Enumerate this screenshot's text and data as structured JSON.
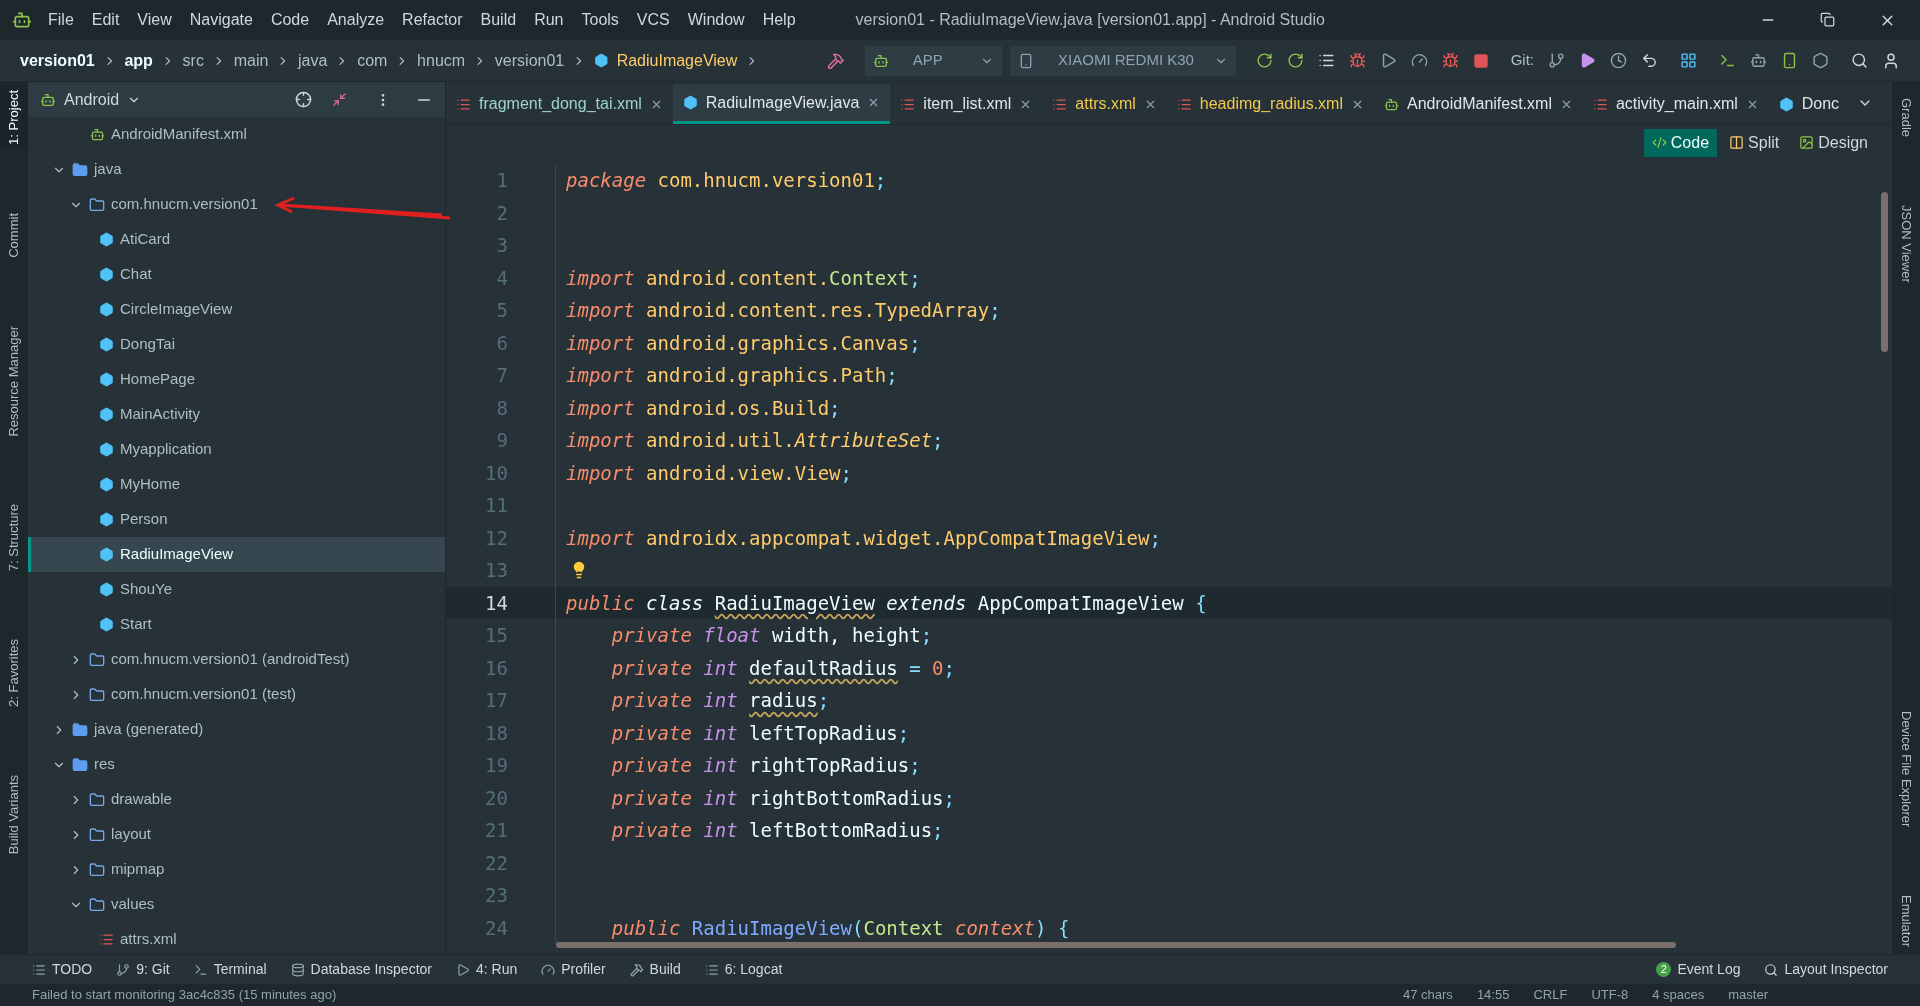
{
  "window": {
    "title": "version01 - RadiuImageView.java [version01.app] - Android Studio"
  },
  "menu": [
    "File",
    "Edit",
    "View",
    "Navigate",
    "Code",
    "Analyze",
    "Refactor",
    "Build",
    "Run",
    "Tools",
    "VCS",
    "Window",
    "Help"
  ],
  "breadcrumb": [
    {
      "label": "version01",
      "kind": "bold"
    },
    {
      "label": "app",
      "kind": "bold"
    },
    {
      "label": "src",
      "kind": "plain"
    },
    {
      "label": "main",
      "kind": "plain"
    },
    {
      "label": "java",
      "kind": "plain"
    },
    {
      "label": "com",
      "kind": "plain"
    },
    {
      "label": "hnucm",
      "kind": "plain"
    },
    {
      "label": "version01",
      "kind": "plain"
    },
    {
      "label": "RadiuImageView",
      "kind": "class"
    }
  ],
  "toolbar": {
    "run_config": "APP",
    "device": "XIAOMI REDMI K30",
    "git_label": "Git:"
  },
  "left_tools": [
    {
      "label": "1: Project",
      "selected": true
    },
    {
      "label": "Commit",
      "selected": false
    },
    {
      "label": "Resource Manager",
      "selected": false
    },
    {
      "label": "7: Structure",
      "selected": false
    },
    {
      "label": "2: Favorites",
      "selected": false
    },
    {
      "label": "Build Variants",
      "selected": false
    }
  ],
  "right_tools": [
    "Gradle",
    "JSON Viewer",
    "Device File Explorer",
    "Emulator"
  ],
  "project": {
    "view": "Android",
    "tree": [
      {
        "label": "AndroidManifest.xml",
        "kind": "manifest",
        "selected": false
      },
      {
        "label": "java",
        "kind": "folder",
        "expanded": true,
        "selected": false,
        "children": [
          {
            "label": "com.hnucm.version01",
            "kind": "package",
            "expanded": true,
            "selected": false,
            "children": [
              {
                "label": "AtiCard",
                "kind": "class",
                "selected": false
              },
              {
                "label": "Chat",
                "kind": "class",
                "selected": false
              },
              {
                "label": "CircleImageView",
                "kind": "class",
                "selected": false
              },
              {
                "label": "DongTai",
                "kind": "class",
                "selected": false
              },
              {
                "label": "HomePage",
                "kind": "class",
                "selected": false
              },
              {
                "label": "MainActivity",
                "kind": "class",
                "selected": false
              },
              {
                "label": "Myapplication",
                "kind": "class",
                "selected": false
              },
              {
                "label": "MyHome",
                "kind": "class",
                "selected": false
              },
              {
                "label": "Person",
                "kind": "class",
                "selected": false
              },
              {
                "label": "RadiuImageView",
                "kind": "class",
                "selected": true
              },
              {
                "label": "ShouYe",
                "kind": "class",
                "selected": false
              },
              {
                "label": "Start",
                "kind": "class",
                "selected": false
              }
            ]
          },
          {
            "label": "com.hnucm.version01 (androidTest)",
            "kind": "package",
            "expanded": false,
            "selected": false
          },
          {
            "label": "com.hnucm.version01 (test)",
            "kind": "package",
            "expanded": false,
            "selected": false
          }
        ]
      },
      {
        "label": "java (generated)",
        "kind": "folder",
        "expanded": false,
        "selected": false
      },
      {
        "label": "res",
        "kind": "folder",
        "expanded": true,
        "selected": false,
        "children": [
          {
            "label": "drawable",
            "kind": "package",
            "expanded": false,
            "selected": false
          },
          {
            "label": "layout",
            "kind": "package",
            "expanded": false,
            "selected": false
          },
          {
            "label": "mipmap",
            "kind": "package",
            "expanded": false,
            "selected": false
          },
          {
            "label": "values",
            "kind": "package",
            "expanded": true,
            "selected": false,
            "children": [
              {
                "label": "attrs.xml",
                "kind": "xml",
                "selected": false
              }
            ]
          }
        ]
      }
    ]
  },
  "tabs": [
    {
      "label": "fragment_dong_tai.xml",
      "kind": "xml",
      "selected": false,
      "color": "#9fd3cc"
    },
    {
      "label": "RadiuImageView.java",
      "kind": "class",
      "selected": true,
      "color": "#e0e6e8"
    },
    {
      "label": "item_list.xml",
      "kind": "xml",
      "selected": false,
      "color": "#e0e6e8"
    },
    {
      "label": "attrs.xml",
      "kind": "xml",
      "selected": false,
      "color": "#f2c94c"
    },
    {
      "label": "headimg_radius.xml",
      "kind": "xml",
      "selected": false,
      "color": "#f2c94c"
    },
    {
      "label": "AndroidManifest.xml",
      "kind": "manifest",
      "selected": false,
      "color": "#e0e6e8"
    },
    {
      "label": "activity_main.xml",
      "kind": "xml",
      "selected": false,
      "color": "#e0e6e8"
    },
    {
      "label": "Donc",
      "kind": "class",
      "selected": false,
      "color": "#e0e6e8"
    }
  ],
  "editor_modes": [
    {
      "label": "Code",
      "selected": true
    },
    {
      "label": "Split",
      "selected": false
    },
    {
      "label": "Design",
      "selected": false
    }
  ],
  "code": [
    {
      "n": "1",
      "current": false,
      "tokens": [
        {
          "text": "package ",
          "kind": "kw"
        },
        {
          "text": "com.hnucm.version01",
          "kind": "pkg"
        },
        {
          "text": ";",
          "kind": "punct"
        }
      ]
    },
    {
      "n": "2",
      "current": false
    },
    {
      "n": "3",
      "current": false
    },
    {
      "n": "4",
      "current": false,
      "tokens": [
        {
          "text": "import ",
          "kind": "kw"
        },
        {
          "text": "android.content.",
          "kind": "pkg"
        },
        {
          "text": "Context",
          "kind": "cls"
        },
        {
          "text": ";",
          "kind": "punct"
        }
      ]
    },
    {
      "n": "5",
      "current": false,
      "tokens": [
        {
          "text": "import ",
          "kind": "kw"
        },
        {
          "text": "android.content.res.TypedArray",
          "kind": "pkg"
        },
        {
          "text": ";",
          "kind": "punct"
        }
      ]
    },
    {
      "n": "6",
      "current": false,
      "tokens": [
        {
          "text": "import ",
          "kind": "kw"
        },
        {
          "text": "android.graphics.Canvas",
          "kind": "pkg"
        },
        {
          "text": ";",
          "kind": "punct"
        }
      ]
    },
    {
      "n": "7",
      "current": false,
      "tokens": [
        {
          "text": "import ",
          "kind": "kw"
        },
        {
          "text": "android.graphics.Path",
          "kind": "pkg"
        },
        {
          "text": ";",
          "kind": "punct"
        }
      ]
    },
    {
      "n": "8",
      "current": false,
      "tokens": [
        {
          "text": "import ",
          "kind": "kw"
        },
        {
          "text": "android.os.Build",
          "kind": "pkg"
        },
        {
          "text": ";",
          "kind": "punct"
        }
      ]
    },
    {
      "n": "9",
      "current": false,
      "tokens": [
        {
          "text": "import ",
          "kind": "kw"
        },
        {
          "text": "android.util.",
          "kind": "pkg"
        },
        {
          "text": "AttributeSet",
          "kind": "ital"
        },
        {
          "text": ";",
          "kind": "punct"
        }
      ]
    },
    {
      "n": "10",
      "current": false,
      "tokens": [
        {
          "text": "import ",
          "kind": "kw"
        },
        {
          "text": "android.view.View",
          "kind": "pkg"
        },
        {
          "text": ";",
          "kind": "punct"
        }
      ]
    },
    {
      "n": "11",
      "current": false
    },
    {
      "n": "12",
      "current": false,
      "tokens": [
        {
          "text": "import ",
          "kind": "kw"
        },
        {
          "text": "androidx.appcompat.widget.AppCompatImageView",
          "kind": "pkg"
        },
        {
          "text": ";",
          "kind": "punct"
        }
      ]
    },
    {
      "n": "13",
      "current": false,
      "bulb": true
    },
    {
      "n": "14",
      "current": true,
      "tokens": [
        {
          "text": "public ",
          "kind": "kw"
        },
        {
          "text": "class ",
          "kind": "kw2"
        },
        {
          "text": "RadiuImageView",
          "kind": "id",
          "warn": true
        },
        {
          "text": " extends ",
          "kind": "kw2"
        },
        {
          "text": "AppCompatImageView",
          "kind": "id"
        },
        {
          "text": " {",
          "kind": "punct"
        }
      ]
    },
    {
      "n": "15",
      "current": false,
      "tokens": [
        {
          "text": "    private ",
          "kind": "kw"
        },
        {
          "text": "float ",
          "kind": "type"
        },
        {
          "text": "width, height",
          "kind": "id"
        },
        {
          "text": ";",
          "kind": "punct"
        }
      ]
    },
    {
      "n": "16",
      "current": false,
      "tokens": [
        {
          "text": "    private ",
          "kind": "kw"
        },
        {
          "text": "int ",
          "kind": "type"
        },
        {
          "text": "defaultRadius",
          "kind": "id",
          "warn": true
        },
        {
          "text": " = ",
          "kind": "punct"
        },
        {
          "text": "0",
          "kind": "num"
        },
        {
          "text": ";",
          "kind": "punct"
        }
      ]
    },
    {
      "n": "17",
      "current": false,
      "tokens": [
        {
          "text": "    private ",
          "kind": "kw"
        },
        {
          "text": "int ",
          "kind": "type"
        },
        {
          "text": "radius",
          "kind": "id",
          "warn": true
        },
        {
          "text": ";",
          "kind": "punct"
        }
      ]
    },
    {
      "n": "18",
      "current": false,
      "tokens": [
        {
          "text": "    private ",
          "kind": "kw"
        },
        {
          "text": "int ",
          "kind": "type"
        },
        {
          "text": "leftTopRadius",
          "kind": "id"
        },
        {
          "text": ";",
          "kind": "punct"
        }
      ]
    },
    {
      "n": "19",
      "current": false,
      "tokens": [
        {
          "text": "    private ",
          "kind": "kw"
        },
        {
          "text": "int ",
          "kind": "type"
        },
        {
          "text": "rightTopRadius",
          "kind": "id"
        },
        {
          "text": ";",
          "kind": "punct"
        }
      ]
    },
    {
      "n": "20",
      "current": false,
      "tokens": [
        {
          "text": "    private ",
          "kind": "kw"
        },
        {
          "text": "int ",
          "kind": "type"
        },
        {
          "text": "rightBottomRadius",
          "kind": "id"
        },
        {
          "text": ";",
          "kind": "punct"
        }
      ]
    },
    {
      "n": "21",
      "current": false,
      "tokens": [
        {
          "text": "    private ",
          "kind": "kw"
        },
        {
          "text": "int ",
          "kind": "type"
        },
        {
          "text": "leftBottomRadius",
          "kind": "id"
        },
        {
          "text": ";",
          "kind": "punct"
        }
      ]
    },
    {
      "n": "22",
      "current": false
    },
    {
      "n": "23",
      "current": false
    },
    {
      "n": "24",
      "current": false,
      "tokens": [
        {
          "text": "    public ",
          "kind": "kw"
        },
        {
          "text": "RadiuImageView",
          "kind": "fn"
        },
        {
          "text": "(",
          "kind": "punct"
        },
        {
          "text": "Context ",
          "kind": "cls"
        },
        {
          "text": "context",
          "kind": "kw"
        },
        {
          "text": ") {",
          "kind": "punct"
        }
      ]
    }
  ],
  "bottom_tools": [
    {
      "label": "TODO",
      "kind": "todo"
    },
    {
      "label": "9: Git",
      "kind": "git"
    },
    {
      "label": "Terminal",
      "kind": "terminal"
    },
    {
      "label": "Database Inspector",
      "kind": "database"
    },
    {
      "label": "4: Run",
      "kind": "run"
    },
    {
      "label": "Profiler",
      "kind": "profiler"
    },
    {
      "label": "Build",
      "kind": "build"
    },
    {
      "label": "6: Logcat",
      "kind": "logcat"
    }
  ],
  "bottom_tools_right": [
    {
      "label": "Event Log",
      "badge": "2"
    },
    {
      "label": "Layout Inspector"
    }
  ],
  "status_bar": {
    "message": "Failed to start monitoring 3ac4c835 (15 minutes ago)",
    "items": [
      "47 chars",
      "14:55",
      "CRLF",
      "UTF-8",
      "4 spaces",
      "master"
    ]
  }
}
